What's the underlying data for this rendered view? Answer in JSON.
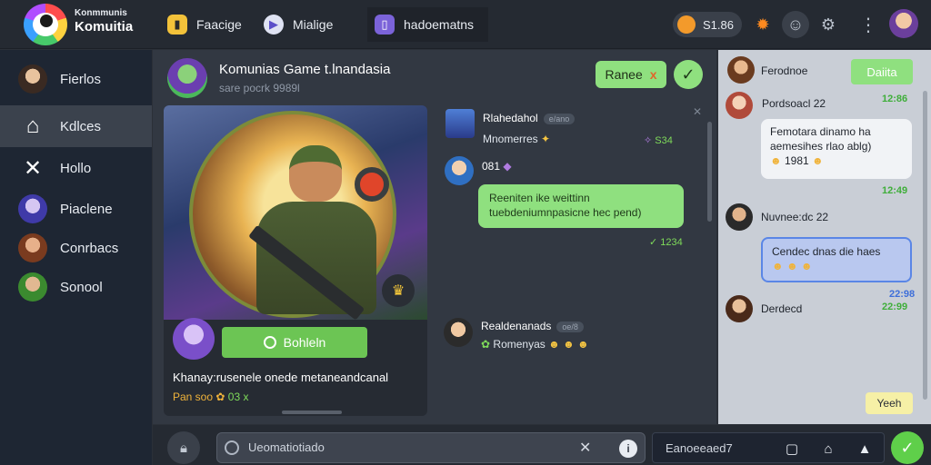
{
  "app": {
    "brand_small": "Konmmunis",
    "brand_big": "Komuitia"
  },
  "top_tabs": [
    {
      "label": "Faacige",
      "icon": "bookmark-icon"
    },
    {
      "label": "Mialige",
      "icon": "play-icon"
    },
    {
      "label": "hadoematns",
      "icon": "phone-icon"
    }
  ],
  "coins": {
    "value": "S1.86"
  },
  "sidebar": {
    "items": [
      {
        "label": "Fierlos",
        "icon": "avatar"
      },
      {
        "label": "Kdlces",
        "icon": "home-icon"
      },
      {
        "label": "Hollo",
        "icon": "swords-icon"
      },
      {
        "label": "Piaclene",
        "icon": "avatar"
      },
      {
        "label": "Conrbacs",
        "icon": "avatar"
      },
      {
        "label": "Sonool",
        "icon": "avatar"
      }
    ]
  },
  "group": {
    "title": "Komunias Game t.lnandasia",
    "subtitle": "sare pocrk 9989l",
    "share_label": "Ranee",
    "share_mark": "x"
  },
  "hero": {
    "follow_label": "Bohleln",
    "description": "Khanay:rusenele onede metaneandcanal",
    "stats_left": "Pan soo",
    "stats_right": "03",
    "stats_mark": "x"
  },
  "main_chat": [
    {
      "name": "Rlahedahol",
      "tag": "e/ano",
      "text": "Mnomerres",
      "time": "S34"
    },
    {
      "name": "081",
      "tag": "",
      "text": "",
      "time": ""
    },
    {
      "name": "Realdenanads",
      "tag": "oe/8",
      "text": "Romenyas",
      "time": ""
    }
  ],
  "main_bubble": {
    "line1": "Reeniten ike weittinn",
    "line2": "tuebdeniumnpasicne hec pend)",
    "time": "1234"
  },
  "right_panel": {
    "pill_label": "Daiita",
    "messages": [
      {
        "name": "Ferodnoe",
        "tag": ""
      },
      {
        "name": "Pordsoacl 22",
        "tag": "",
        "time": "12:86"
      },
      {
        "name": "Nuvnee:dc 22",
        "tag": "",
        "time": "12:49"
      },
      {
        "name": "Derdecd",
        "tag": "",
        "time": "22:99"
      }
    ],
    "white_bubble": {
      "line1": "Femotara dinamo ha",
      "line2": "aemesihes rlao ablg)",
      "line3": "1981"
    },
    "white_time": "12:49",
    "blue_bubble": {
      "line1": "Cendec dnas die haes",
      "line2": ""
    },
    "blue_time": "22:98",
    "reply_label": "Yeeh"
  },
  "composer": {
    "placeholder": "Ueomatiotiado",
    "reply_label": "Eanoeeaed7"
  },
  "colors": {
    "accent_green": "#8fe07f",
    "follow_green": "#6cc554",
    "sidebar_bg": "#1e2633",
    "main_bg": "#323842"
  }
}
